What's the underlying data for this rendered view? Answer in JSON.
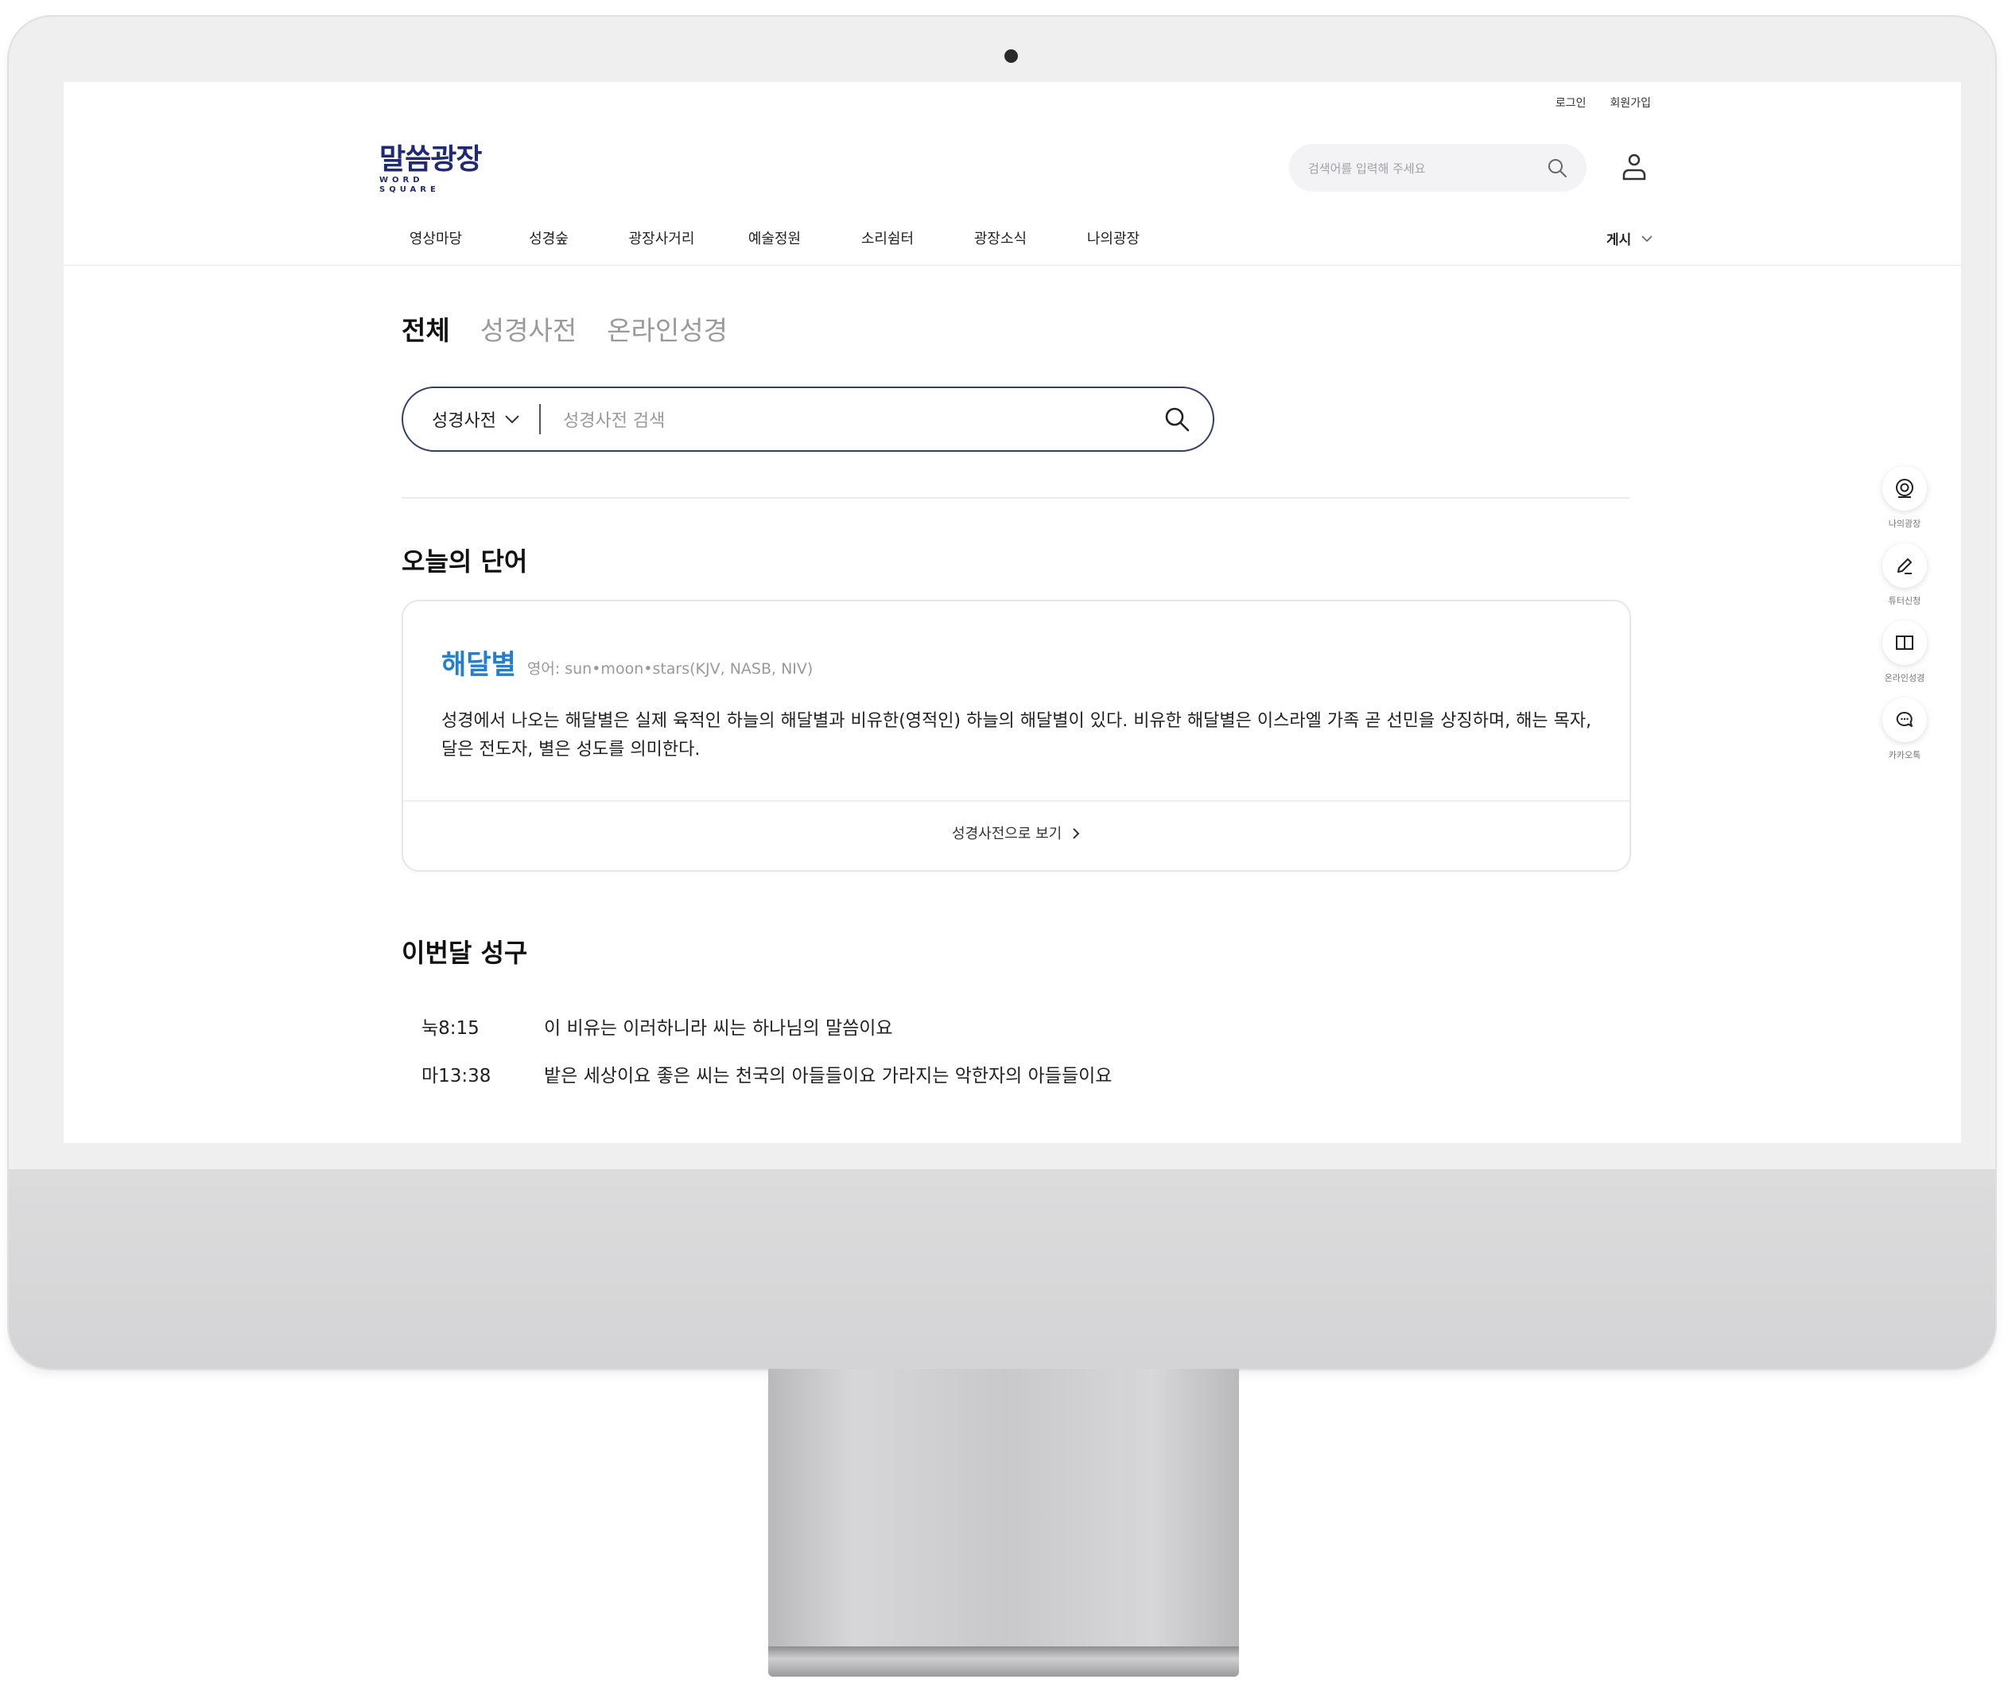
{
  "header": {
    "util_links": [
      "로그인",
      "회원가입"
    ],
    "logo": {
      "korean": "말씀광장",
      "english": "WORD SQUARE",
      "color": "#1e2a78"
    },
    "search_placeholder": "검색어를 입력해 주세요",
    "nav": [
      "영상마당",
      "성경숲",
      "광장사거리",
      "예술정원",
      "소리쉼터",
      "광장소식",
      "나의광장"
    ],
    "board_select": "게시"
  },
  "tabs": {
    "active": "전체",
    "items": [
      "성경사전",
      "온라인성경"
    ]
  },
  "search": {
    "scope": "성경사전",
    "placeholder": "성경사전 검색"
  },
  "today_word": {
    "section_title": "오늘의 단어",
    "word": "해달별",
    "english": "영어: sun•moon•stars(KJV, NASB, NIV)",
    "description": "성경에서 나오는 해달별은 실제 육적인 하늘의 해달별과 비유한(영적인) 하늘의 해달별이 있다. 비유한 해달별은 이스라엘 가족 곧 선민을 상징하며, 해는 목자, 달은 전도자, 별은 성도를 의미한다.",
    "link": "성경사전으로 보기",
    "accent_color": "#1f7ed6"
  },
  "monthly_verses": {
    "section_title": "이번달 성구",
    "items": [
      {
        "ref": "눅8:15",
        "text": "이 비유는 이러하니라 씨는 하나님의 말씀이요"
      },
      {
        "ref": "마13:38",
        "text": "밭은 세상이요 좋은 씨는 천국의 아들들이요 가라지는 악한자의 아들들이요"
      }
    ]
  },
  "quick_menu": [
    {
      "label": "나의광장",
      "icon": "my-square-icon"
    },
    {
      "label": "튜터신청",
      "icon": "pen-icon"
    },
    {
      "label": "온라인성경",
      "icon": "book-icon"
    },
    {
      "label": "카카오톡",
      "icon": "chat-icon"
    }
  ]
}
